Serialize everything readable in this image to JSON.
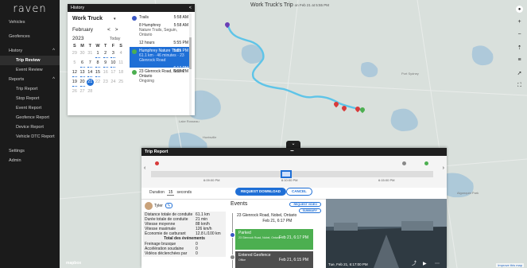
{
  "logo": "raven",
  "sidebar": {
    "items": [
      {
        "label": "Vehicles"
      },
      {
        "label": "Geofences"
      },
      {
        "label": "History",
        "chevron": "^"
      },
      {
        "label": "Trip Review",
        "active": true
      },
      {
        "label": "Event Review"
      },
      {
        "label": "Reports",
        "chevron": "^"
      },
      {
        "label": "Trip Report"
      },
      {
        "label": "Stop Report"
      },
      {
        "label": "Event Report"
      },
      {
        "label": "Geofence Report"
      },
      {
        "label": "Device Report"
      },
      {
        "label": "Vehicle DTC Report"
      },
      {
        "label": "Settings"
      },
      {
        "label": "Admin"
      }
    ]
  },
  "map": {
    "title": "Work Truck's Trip",
    "title_suffix": "on Feb 21 at 5:55 PM",
    "attribution": "Improve this map",
    "brand_mark": "mapbox",
    "places": [
      "Huntsville",
      "Lake of Bays",
      "Lake Rosseau",
      "Port Sydney",
      "Algonquin Park"
    ],
    "controls": [
      "account-icon",
      "zoom-in-icon",
      "zoom-out-icon",
      "compass-icon",
      "layers-icon",
      "locate-icon",
      "fullscreen-icon"
    ],
    "route_color": "#5ec4e8"
  },
  "history": {
    "title": "History",
    "close": "<",
    "vehicle": "Work Truck",
    "month": "February",
    "year": "2023",
    "nav_prev": "<",
    "nav_next": ">",
    "today": "Today",
    "dow": [
      "S",
      "M",
      "T",
      "W",
      "T",
      "F",
      "S"
    ],
    "days": [
      {
        "d": "29",
        "muted": true
      },
      {
        "d": "30",
        "muted": true
      },
      {
        "d": "31",
        "muted": true
      },
      {
        "d": "1",
        "dot": true
      },
      {
        "d": "2",
        "dot": true
      },
      {
        "d": "3",
        "dot": true
      },
      {
        "d": "4",
        "muted": true
      },
      {
        "d": "5",
        "muted": true
      },
      {
        "d": "6",
        "dot": true
      },
      {
        "d": "7",
        "dot": true
      },
      {
        "d": "8",
        "dot": true
      },
      {
        "d": "9",
        "dot": true
      },
      {
        "d": "10",
        "dot": true
      },
      {
        "d": "11",
        "muted": true
      },
      {
        "d": "12",
        "dot": true
      },
      {
        "d": "13",
        "dot": true
      },
      {
        "d": "14",
        "dot": true
      },
      {
        "d": "15",
        "dot": true
      },
      {
        "d": "16",
        "muted": true
      },
      {
        "d": "17",
        "muted": true
      },
      {
        "d": "18",
        "muted": true
      },
      {
        "d": "19",
        "dot": true
      },
      {
        "d": "20",
        "dot": true
      },
      {
        "d": "21",
        "sel": true
      },
      {
        "d": "22",
        "muted": true
      },
      {
        "d": "23",
        "muted": true
      },
      {
        "d": "24",
        "muted": true
      },
      {
        "d": "25",
        "muted": true
      },
      {
        "d": "26",
        "muted": true
      },
      {
        "d": "27",
        "muted": true
      },
      {
        "d": "28",
        "muted": true
      },
      {
        "d": "",
        "muted": true
      },
      {
        "d": "",
        "muted": true
      },
      {
        "d": "",
        "muted": true
      },
      {
        "d": "",
        "muted": true
      }
    ],
    "trips": [
      {
        "title": "Trails",
        "time": "5:58 AM",
        "sub": "",
        "marker": "#3a57c4"
      },
      {
        "title": "8 Humphrey",
        "time": "5:58 AM",
        "sub": "Nature Trails, Seguin, Ontario",
        "marker": ""
      },
      {
        "title": "12 hours",
        "time": "5:55 PM",
        "sub": "",
        "marker": ""
      },
      {
        "title": "Humphrey Nature Trails",
        "time": "5:55 PM",
        "sub": "61.1 km · 46 minutes · 23 Glenrock Road",
        "marker": "#4caf50",
        "selected": true
      },
      {
        "title": "",
        "time": "6:17 PM",
        "sub": "",
        "marker": "",
        "selected": true
      },
      {
        "title": "23 Glenrock Road, Nobel, Ontario",
        "time": "6:17 PM",
        "sub": "Ongoing",
        "marker": "#4caf50"
      }
    ]
  },
  "report": {
    "title": "Trip Report",
    "ticks": [
      "6:09:00 PM",
      "6:10:00 PM",
      "6:15:00 PM"
    ],
    "duration_label": "Duration",
    "duration_value": "15",
    "duration_unit": "seconds",
    "request_download": "REQUEST DOWNLOAD",
    "cancel": "CANCEL",
    "timeline_position": 0.48
  },
  "driver": {
    "name": "Tyler",
    "stats": [
      {
        "label": "Distance totale de conduite",
        "value": "61.1 km"
      },
      {
        "label": "Durée totale de conduite",
        "value": "21 min"
      },
      {
        "label": "Vitesse moyenne",
        "value": "88 km/h"
      },
      {
        "label": "Vitesse maximale",
        "value": "126 km/h"
      },
      {
        "label": "Économie de carburant",
        "value": "12.8 L/100 km"
      }
    ],
    "section": "Total des événements",
    "events": [
      {
        "label": "Freinage brusque",
        "value": "0"
      },
      {
        "label": "Accélération soudaine",
        "value": "0"
      },
      {
        "label": "Vidéos déclenchées par",
        "value": "0"
      }
    ]
  },
  "events": {
    "title": "Events",
    "request_video": "REQUEST VIDEO",
    "summary": "SUMMARY",
    "address": "23 Glenrock Road, Nobel, Ontario",
    "address_time": "Feb 21, 6:17 PM",
    "cards": [
      {
        "title": "Parked",
        "sub": "23 Glenrock Road, Nobel, Ontario",
        "time": "Feb 21, 6:17 PM",
        "color": "#4caf50"
      },
      {
        "title": "Entered Geofence",
        "sub": "Office",
        "time": "Feb 21, 6:15 PM",
        "color": "#4e4e4e"
      }
    ]
  },
  "video": {
    "timestamp": "Tue, Feb 21, 6:17:00 PM"
  }
}
